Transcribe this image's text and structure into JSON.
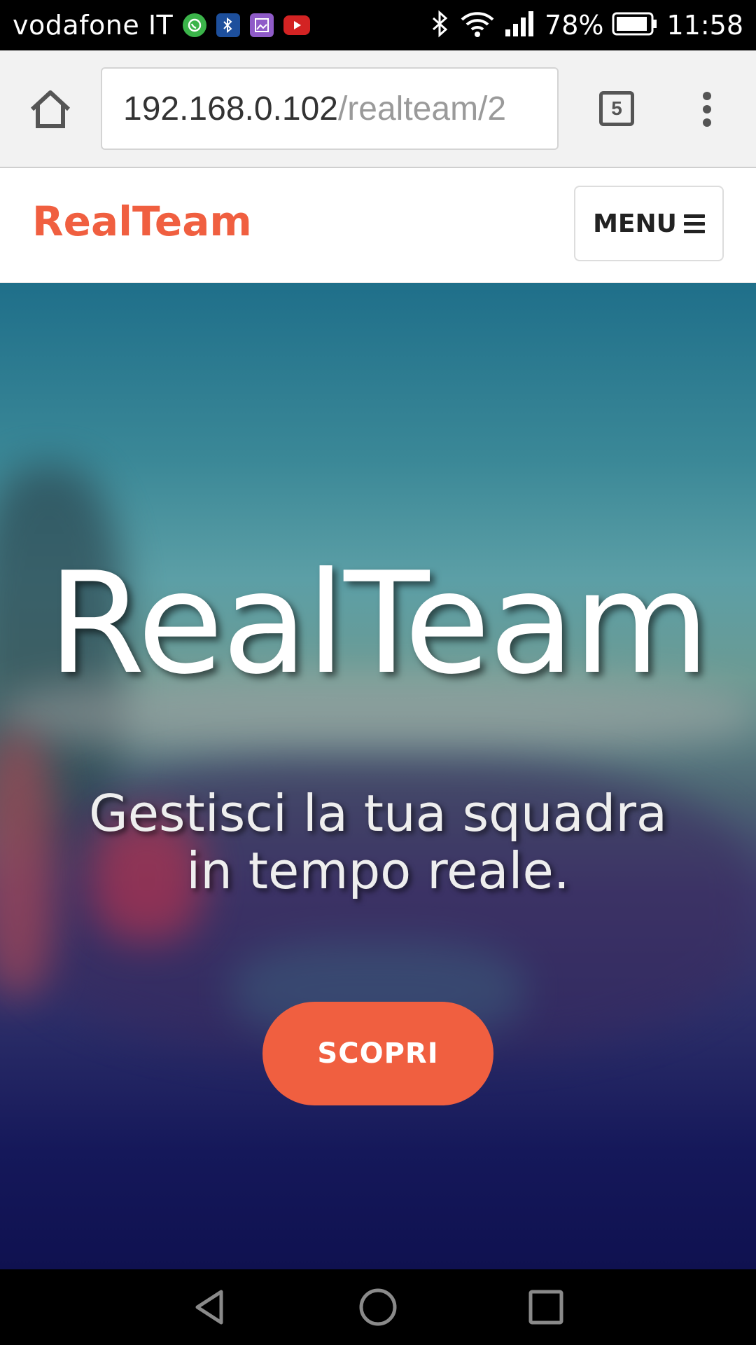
{
  "status_bar": {
    "carrier": "vodafone IT",
    "battery": "78%",
    "time": "11:58",
    "notification_icons": [
      "whatsapp-icon",
      "bluetooth-icon",
      "gallery-icon",
      "youtube-icon"
    ],
    "system_icons": [
      "bluetooth-icon",
      "wifi-icon",
      "signal-icon",
      "battery-icon"
    ]
  },
  "browser": {
    "url_host": "192.168.0.102",
    "url_path": "/realteam/2",
    "tab_count": "5"
  },
  "navbar": {
    "brand": "RealTeam",
    "menu_label": "MENU"
  },
  "hero": {
    "title": "RealTeam",
    "subtitle": "Gestisci la tua squadra in tempo reale.",
    "cta_label": "SCOPRI"
  },
  "colors": {
    "accent": "#f05f40",
    "hero_top": "#1f6f8a",
    "hero_bottom": "#0f1150"
  }
}
